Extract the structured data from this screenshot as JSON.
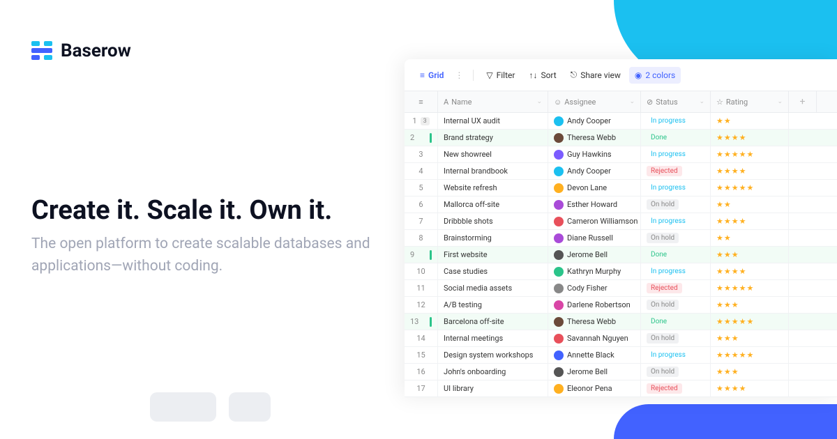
{
  "brand": "Baserow",
  "headline": "Create it. Scale it. Own it.",
  "subhead": "The open platform to create scalable databases and applications—without coding.",
  "toolbar": {
    "view": "Grid",
    "filter": "Filter",
    "sort": "Sort",
    "share": "Share view",
    "colors": "2 colors"
  },
  "columns": {
    "name": "Name",
    "assignee": "Assignee",
    "status": "Status",
    "rating": "Rating"
  },
  "rows": [
    {
      "n": "1",
      "badge": "3",
      "name": "Internal UX audit",
      "assignee": "Andy Cooper",
      "av": "#1bc0f0",
      "status": "In progress",
      "st": "prog",
      "stars": 2
    },
    {
      "n": "2",
      "done": true,
      "name": "Brand strategy",
      "assignee": "Theresa Webb",
      "av": "#6b4a3a",
      "status": "Done",
      "st": "done",
      "stars": 4
    },
    {
      "n": "3",
      "name": "New showreel",
      "assignee": "Guy Hawkins",
      "av": "#7b5cff",
      "status": "In progress",
      "st": "prog",
      "stars": 5
    },
    {
      "n": "4",
      "name": "Internal brandbook",
      "assignee": "Andy Cooper",
      "av": "#1bc0f0",
      "status": "Rejected",
      "st": "rej",
      "stars": 4
    },
    {
      "n": "5",
      "name": "Website refresh",
      "assignee": "Devon Lane",
      "av": "#ffb020",
      "status": "In progress",
      "st": "prog",
      "stars": 5
    },
    {
      "n": "6",
      "name": "Mallorca off-site",
      "assignee": "Esther Howard",
      "av": "#a94bd8",
      "status": "On hold",
      "st": "hold",
      "stars": 2
    },
    {
      "n": "7",
      "name": "Dribbble shots",
      "assignee": "Cameron Williamson",
      "av": "#e8505b",
      "status": "In progress",
      "st": "prog",
      "stars": 4
    },
    {
      "n": "8",
      "name": "Brainstorming",
      "assignee": "Diane Russell",
      "av": "#a94bd8",
      "status": "On hold",
      "st": "hold",
      "stars": 2
    },
    {
      "n": "9",
      "done": true,
      "name": "First website",
      "assignee": "Jerome Bell",
      "av": "#555",
      "status": "Done",
      "st": "done",
      "stars": 3
    },
    {
      "n": "10",
      "name": "Case studies",
      "assignee": "Kathryn Murphy",
      "av": "#2bc48a",
      "status": "In progress",
      "st": "prog",
      "stars": 4
    },
    {
      "n": "11",
      "name": "Social media assets",
      "assignee": "Cody Fisher",
      "av": "#888",
      "status": "Rejected",
      "st": "rej",
      "stars": 5
    },
    {
      "n": "12",
      "name": "A/B testing",
      "assignee": "Darlene Robertson",
      "av": "#d946a6",
      "status": "On hold",
      "st": "hold",
      "stars": 3
    },
    {
      "n": "13",
      "done": true,
      "name": "Barcelona off-site",
      "assignee": "Theresa Webb",
      "av": "#6b4a3a",
      "status": "Done",
      "st": "done",
      "stars": 5
    },
    {
      "n": "14",
      "name": "Internal meetings",
      "assignee": "Savannah Nguyen",
      "av": "#e8505b",
      "status": "On hold",
      "st": "hold",
      "stars": 3
    },
    {
      "n": "15",
      "name": "Design system workshops",
      "assignee": "Annette Black",
      "av": "#4262ff",
      "status": "In progress",
      "st": "prog",
      "stars": 5
    },
    {
      "n": "16",
      "name": "John's onboarding",
      "assignee": "Jerome Bell",
      "av": "#555",
      "status": "On hold",
      "st": "hold",
      "stars": 3
    },
    {
      "n": "17",
      "name": "UI library",
      "assignee": "Eleonor Pena",
      "av": "#ffb020",
      "status": "Rejected",
      "st": "rej",
      "stars": 4
    }
  ]
}
